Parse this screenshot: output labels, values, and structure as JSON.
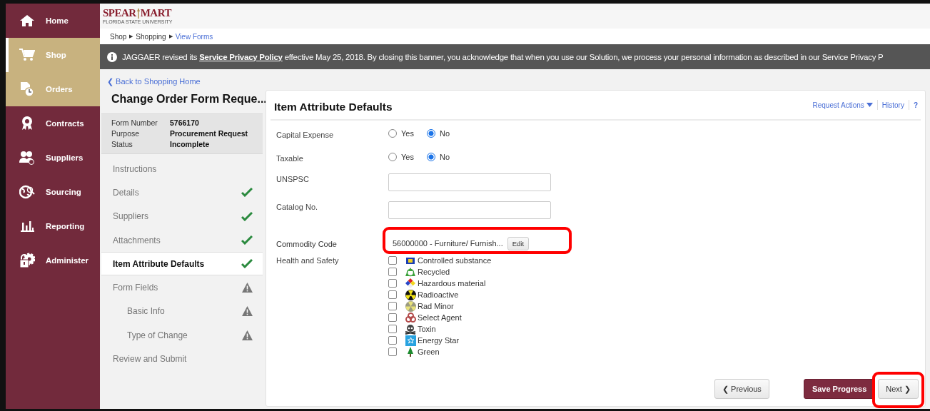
{
  "sidebar": {
    "items": [
      {
        "label": "Home",
        "selected": false
      },
      {
        "label": "Shop",
        "selected": true
      },
      {
        "label": "Orders",
        "selected": true
      },
      {
        "label": "Contracts",
        "selected": false
      },
      {
        "label": "Suppliers",
        "selected": false
      },
      {
        "label": "Sourcing",
        "selected": false
      },
      {
        "label": "Reporting",
        "selected": false
      },
      {
        "label": "Administer",
        "selected": false
      }
    ]
  },
  "header": {
    "logo": "SPEAR",
    "logo_2": "MART",
    "logo_sub": "FLORIDA STATE UNIVERSITY"
  },
  "breadcrumb": [
    {
      "kind": "item",
      "label": "Shop"
    },
    {
      "kind": "separator",
      "label": "▶"
    },
    {
      "kind": "item",
      "label": "Shopping"
    },
    {
      "kind": "separator",
      "label": "▶"
    },
    {
      "kind": "link",
      "label": "View Forms"
    }
  ],
  "banner": {
    "before": "JAGGAER revised its ",
    "link": "Service Privacy Policy",
    "after": " effective May 25, 2018. By closing this banner, you acknowledge that when you use our Solution, we process your personal information as described in our Service Privacy P"
  },
  "back_link": "❮ Back to Shopping Home",
  "form": {
    "title": "Change Order Form Reque...",
    "info": [
      {
        "label": "Form Number",
        "value": "5766170"
      },
      {
        "label": "Purpose",
        "value": "Procurement Request"
      },
      {
        "label": "Status",
        "value": "Incomplete"
      }
    ],
    "steps": [
      {
        "label": "Instructions",
        "complete": false,
        "warning": false,
        "selected": false
      },
      {
        "label": "Details",
        "complete": true,
        "warning": false,
        "selected": false
      },
      {
        "label": "Suppliers",
        "complete": true,
        "warning": false,
        "selected": false
      },
      {
        "label": "Attachments",
        "complete": true,
        "warning": false,
        "selected": false
      },
      {
        "label": "Item Attribute Defaults",
        "complete": true,
        "warning": false,
        "selected": true
      },
      {
        "label": "Form Fields",
        "complete": false,
        "warning": true,
        "selected": false,
        "children": [
          {
            "label": "Basic Info",
            "complete": false,
            "warning": true,
            "selected": false
          },
          {
            "label": "Type of Change",
            "complete": false,
            "warning": true,
            "selected": false
          }
        ]
      },
      {
        "label": "Review and Submit",
        "complete": false,
        "warning": false,
        "selected": false
      }
    ]
  },
  "card": {
    "title": "Item Attribute Defaults",
    "actions": [
      {
        "label": "Request Actions",
        "kind": "menu"
      },
      {
        "label": "History",
        "kind": "link"
      },
      {
        "label": "?",
        "kind": "help"
      }
    ],
    "fields": [
      {
        "kind": "radio",
        "label": "Capital Expense",
        "options": [
          {
            "label": "Yes",
            "selected": false
          },
          {
            "label": "No",
            "selected": true
          }
        ]
      },
      {
        "kind": "radio",
        "label": "Taxable",
        "options": [
          {
            "label": "Yes",
            "selected": false
          },
          {
            "label": "No",
            "selected": true
          }
        ]
      },
      {
        "kind": "text",
        "label": "UNSPSC"
      },
      {
        "kind": "text",
        "label": "Catalog No."
      },
      {
        "kind": "code",
        "label": "Commodity Code",
        "value": "56000000 - Furniture/ Furnish...",
        "button": "Edit",
        "highlighted": true
      },
      {
        "kind": "checklist",
        "label": "Health and Safety",
        "options": [
          {
            "label": "Controlled substance",
            "checked": false
          },
          {
            "label": "Recycled",
            "checked": false
          },
          {
            "label": "Hazardous material",
            "checked": false
          },
          {
            "label": "Radioactive",
            "checked": false
          },
          {
            "label": "Rad Minor",
            "checked": false
          },
          {
            "label": "Select Agent",
            "checked": false
          },
          {
            "label": "Toxin",
            "checked": false
          },
          {
            "label": "Energy Star",
            "checked": false
          },
          {
            "label": "Green",
            "checked": false
          }
        ]
      }
    ],
    "buttons": [
      {
        "label": "❮ Previous",
        "kind": "prev",
        "highlighted": false
      },
      {
        "label": "Save Progress",
        "kind": "primary",
        "highlighted": false
      },
      {
        "label": "Next ❯",
        "kind": "next",
        "highlighted": true
      }
    ]
  }
}
